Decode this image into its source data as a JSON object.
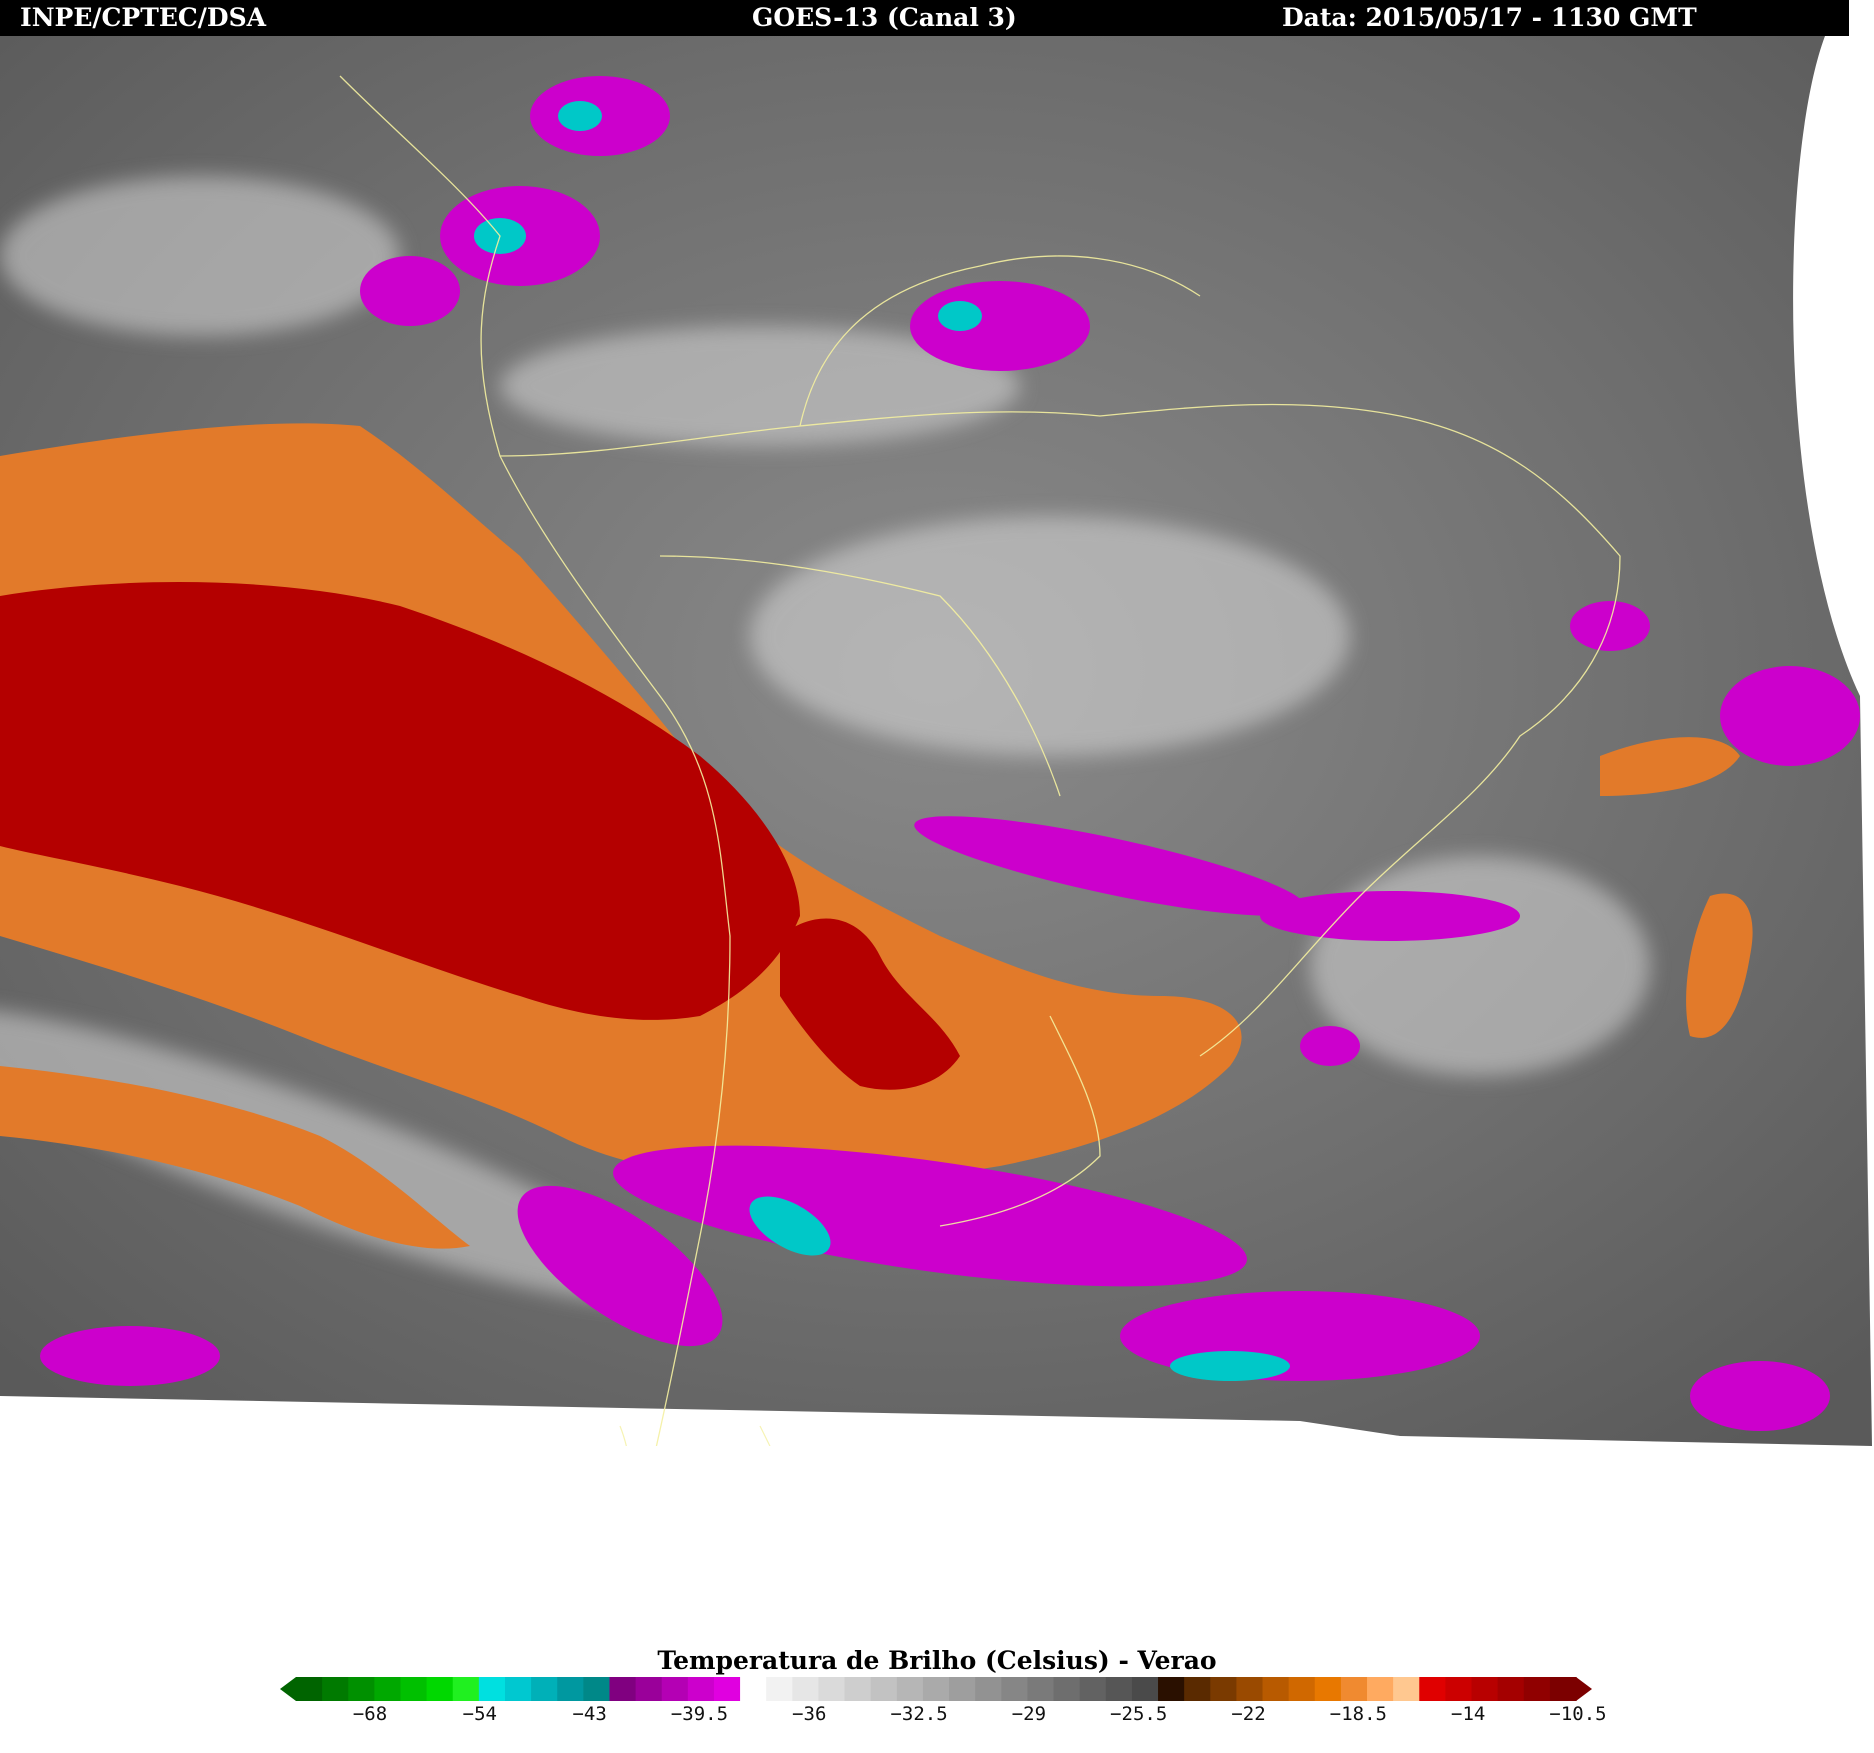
{
  "header": {
    "left": "INPE/CPTEC/DSA",
    "center": "GOES-13 (Canal 3)",
    "right": "Data: 2015/05/17 - 1130 GMT"
  },
  "colorbar": {
    "title": "Temperatura de Brilho (Celsius) - Verao",
    "ticks": [
      "−68",
      "−54",
      "−43",
      "−39.5",
      "−36",
      "−32.5",
      "−29",
      "−25.5",
      "−22",
      "−18.5",
      "−14",
      "−10.5"
    ],
    "segments": [
      "#006400",
      "#007a00",
      "#009000",
      "#00a800",
      "#00c000",
      "#00d800",
      "#20f020",
      "#00e0e0",
      "#00c8d0",
      "#00b0b8",
      "#0098a0",
      "#008888",
      "#800080",
      "#9a009a",
      "#b400b4",
      "#cc00cc",
      "#e000e0",
      "#ffffff",
      "#f2f2f2",
      "#e6e6e6",
      "#dadada",
      "#cecece",
      "#c2c2c2",
      "#b6b6b6",
      "#aaaaaa",
      "#9e9e9e",
      "#929292",
      "#868686",
      "#7a7a7a",
      "#6e6e6e",
      "#626262",
      "#565656",
      "#4a4a4a",
      "#2a1000",
      "#5a2a00",
      "#7a3a00",
      "#9a4a00",
      "#b85a00",
      "#d06800",
      "#e87800",
      "#f08a30",
      "#ffaa60",
      "#ffc890",
      "#e00000",
      "#cc0000",
      "#b80000",
      "#a40000",
      "#900000",
      "#7c0000"
    ]
  },
  "palette": {
    "background_gray": "#6a6a6a",
    "red": "#b40000",
    "orange": "#e27a2a",
    "magenta": "#cc00cc",
    "cyan": "#00c8c8",
    "border_yellow": "#f4f0a0"
  }
}
